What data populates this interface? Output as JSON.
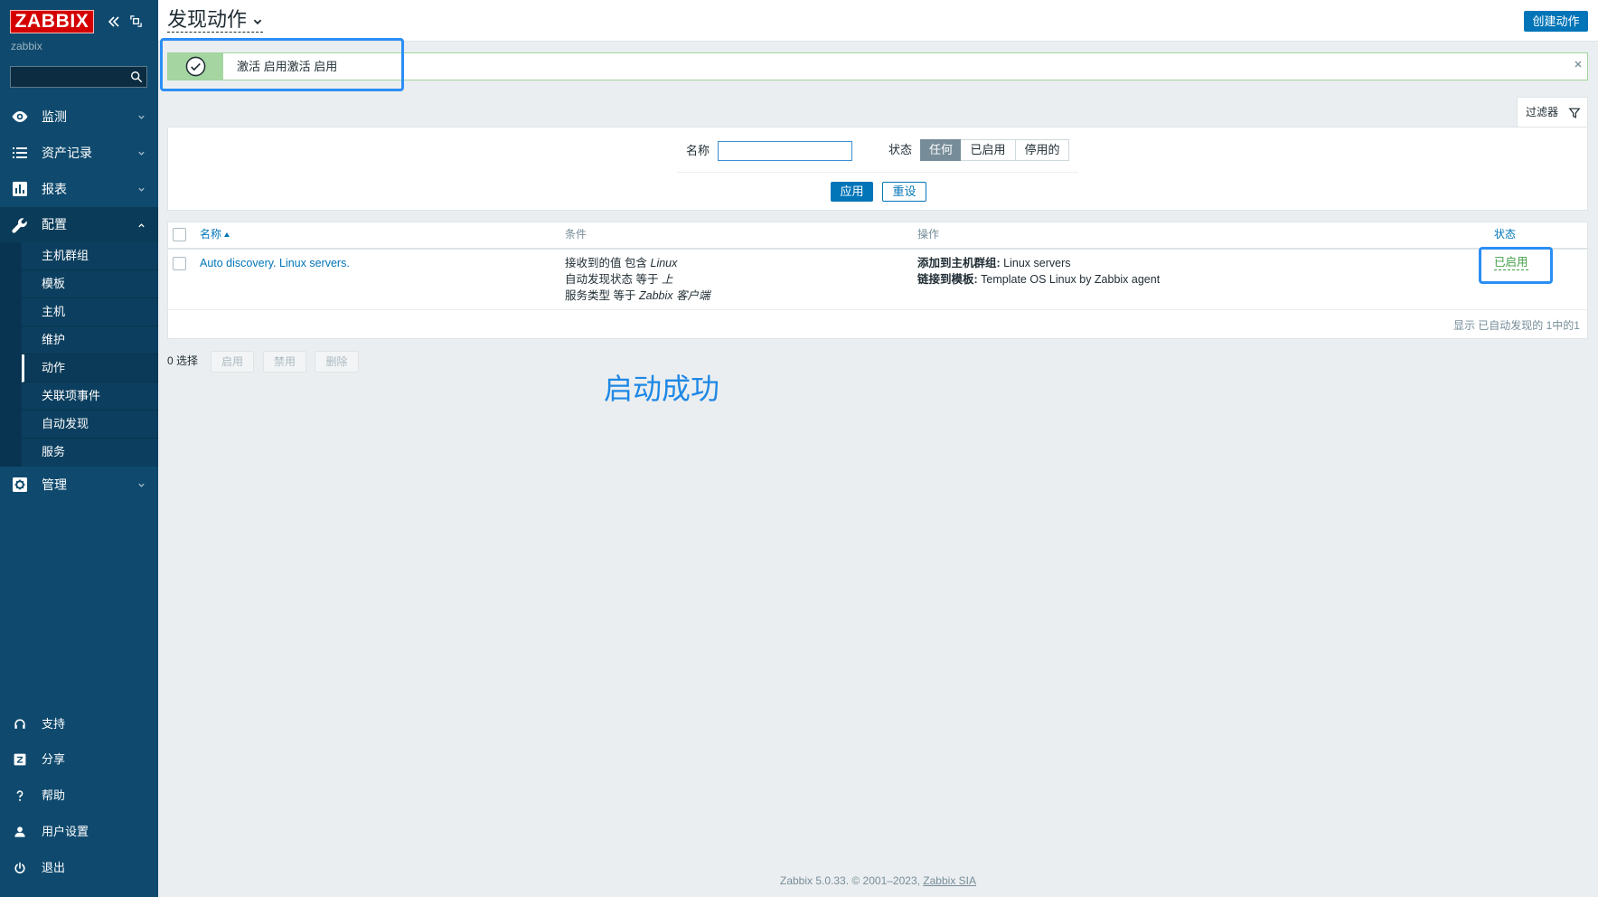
{
  "logo": {
    "text": "ZABBIX",
    "server_name": "zabbix"
  },
  "sidebar": {
    "search": {
      "value": ""
    },
    "menu": [
      {
        "label": "监测",
        "icon": "eye-icon"
      },
      {
        "label": "资产记录",
        "icon": "list-icon"
      },
      {
        "label": "报表",
        "icon": "bar-chart-icon"
      },
      {
        "label": "配置",
        "icon": "wrench-icon",
        "expanded": true
      },
      {
        "label": "管理",
        "icon": "gear-icon"
      }
    ],
    "submenu": [
      "主机群组",
      "模板",
      "主机",
      "维护",
      "动作",
      "关联项事件",
      "自动发现",
      "服务"
    ],
    "submenu_selected": "动作",
    "bottom": [
      {
        "label": "支持",
        "icon": "headset-icon"
      },
      {
        "label": "分享",
        "icon": "share-icon"
      },
      {
        "label": "帮助",
        "icon": "help-icon"
      },
      {
        "label": "用户设置",
        "icon": "user-icon"
      },
      {
        "label": "退出",
        "icon": "power-icon"
      }
    ]
  },
  "header": {
    "title": "发现动作",
    "create_button": "创建动作"
  },
  "message": {
    "type": "success",
    "text": "激活 启用激活 启用"
  },
  "filter": {
    "tab_label": "过滤器",
    "name_label": "名称",
    "name_value": "",
    "status_label": "状态",
    "status_options": [
      "任何",
      "已启用",
      "停用的"
    ],
    "status_selected": "任何",
    "apply_button": "应用",
    "reset_button": "重设"
  },
  "table": {
    "headers": {
      "name": "名称",
      "conditions": "条件",
      "operations": "操作",
      "status": "状态"
    },
    "sort": {
      "column": "name",
      "direction": "asc"
    },
    "rows": [
      {
        "name": "Auto discovery. Linux servers.",
        "conditions": [
          {
            "field": "接收到的值",
            "op": "包含",
            "value": "Linux"
          },
          {
            "field": "自动发现状态",
            "op": "等于",
            "value": "上"
          },
          {
            "field": "服务类型",
            "op": "等于",
            "value": "Zabbix 客户端"
          }
        ],
        "operations": [
          {
            "label": "添加到主机群组:",
            "value": "Linux servers"
          },
          {
            "label": "链接到模板:",
            "value": "Template OS Linux by Zabbix agent"
          }
        ],
        "status": "已启用"
      }
    ],
    "footer": "显示 已自动发现的 1中的1"
  },
  "mass_actions": {
    "selected": "0 选择",
    "buttons": [
      "启用",
      "禁用",
      "删除"
    ]
  },
  "annotation": {
    "text": "启动成功"
  },
  "footer": {
    "text": "Zabbix 5.0.33. © 2001–2023, ",
    "link": "Zabbix SIA"
  },
  "colors": {
    "sidebar": "#0f4a6e",
    "accent": "#0275b8",
    "success": "#429e47",
    "logo": "#d40000",
    "annotation": "#2b8ef5"
  }
}
